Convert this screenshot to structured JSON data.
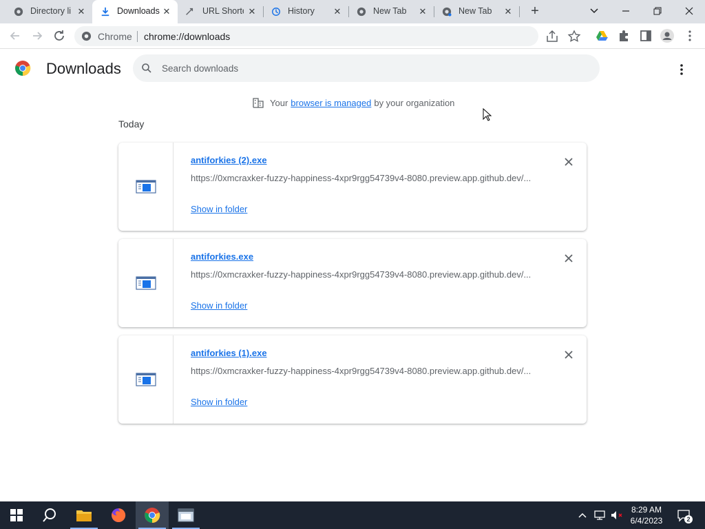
{
  "tabs": [
    {
      "label": "Directory li",
      "icon": "chrome-icon",
      "active": false
    },
    {
      "label": "Downloads",
      "icon": "download-icon",
      "active": true
    },
    {
      "label": "URL Shorte",
      "icon": "link-icon",
      "active": false
    },
    {
      "label": "History",
      "icon": "history-icon",
      "active": false
    },
    {
      "label": "New Tab",
      "icon": "chrome-icon",
      "active": false
    },
    {
      "label": "New Tab",
      "icon": "chrome-icon",
      "active": false
    }
  ],
  "omnibox": {
    "chip": "Chrome",
    "url": "chrome://downloads"
  },
  "page": {
    "title": "Downloads"
  },
  "search": {
    "placeholder": "Search downloads"
  },
  "managed": {
    "prefix": "Your",
    "link": "browser is managed",
    "suffix": "by your organization"
  },
  "section": {
    "date": "Today"
  },
  "downloads": [
    {
      "filename": "antiforkies (2).exe",
      "url": "https://0xmcraxker-fuzzy-happiness-4xpr9rgg54739v4-8080.preview.app.github.dev/...",
      "action": "Show in folder"
    },
    {
      "filename": "antiforkies.exe",
      "url": "https://0xmcraxker-fuzzy-happiness-4xpr9rgg54739v4-8080.preview.app.github.dev/...",
      "action": "Show in folder"
    },
    {
      "filename": "antiforkies (1).exe",
      "url": "https://0xmcraxker-fuzzy-happiness-4xpr9rgg54739v4-8080.preview.app.github.dev/...",
      "action": "Show in folder"
    }
  ],
  "taskbar": {
    "apps": [
      "start-icon",
      "search-icon",
      "file-explorer-icon",
      "firefox-icon",
      "chrome-icon",
      "app-window-icon"
    ],
    "time": "8:29 AM",
    "date": "6/4/2023",
    "notifications": "2"
  },
  "colors": {
    "accent": "#1a73e8",
    "tabstrip": "#dee1e6",
    "taskbar": "#1c2431"
  }
}
